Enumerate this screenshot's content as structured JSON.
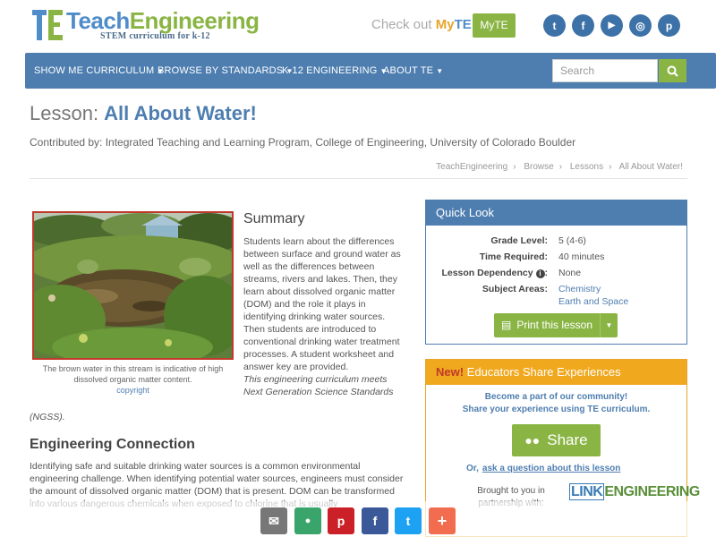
{
  "header": {
    "logo": {
      "part1": "Teach",
      "part2": "Engineering",
      "tagline": "STEM curriculum for k-12"
    },
    "checkout": {
      "prefix": "Check out ",
      "my": "My",
      "te": "TE"
    },
    "myte_button": "MyTE",
    "socials": [
      {
        "icon": "twitter-icon",
        "glyph": "t"
      },
      {
        "icon": "facebook-icon",
        "glyph": "f"
      },
      {
        "icon": "youtube-icon",
        "glyph": "▶"
      },
      {
        "icon": "instagram-icon",
        "glyph": "◎"
      },
      {
        "icon": "pinterest-icon",
        "glyph": "p"
      }
    ]
  },
  "nav": {
    "items": [
      "SHOW ME CURRICULUM",
      "BROWSE BY STANDARDS",
      "K-12 ENGINEERING",
      "ABOUT TE"
    ],
    "search_placeholder": "Search"
  },
  "lesson": {
    "prefix": "Lesson: ",
    "title": "All About Water!",
    "contributed": "Contributed by: Integrated Teaching and Learning Program, College of Engineering, University of Colorado Boulder"
  },
  "breadcrumb": [
    "TeachEngineering",
    "Browse",
    "Lessons",
    "All About Water!"
  ],
  "figure": {
    "caption": "The brown water in this stream is indicative of high dissolved organic matter content.",
    "credit": "copyright"
  },
  "summary": {
    "heading": "Summary",
    "body": "Students learn about the differences between surface and ground water as well as the differences between streams, rivers and lakes. Then, they learn about dissolved organic matter (DOM) and the role it plays in identifying drinking water sources. Then students are introduced to conventional drinking water treatment processes. A student worksheet and answer key are provided.",
    "ngss_1": "This engineering curriculum meets",
    "ngss_2": "Next Generation Science Standards",
    "ngss_3": "(NGSS)."
  },
  "engineering": {
    "heading": "Engineering Connection",
    "body": "Identifying safe and suitable drinking water sources is a common environmental engineering challenge. When identifying potential water sources, engineers must consider the amount of dissolved organic matter (DOM) that is present. DOM can be transformed into various dangerous chemicals when exposed to chlorine that is usually"
  },
  "quick_look": {
    "heading": "Quick Look",
    "grade_label": "Grade Level:",
    "grade_value": "5 (4-6)",
    "time_label": "Time Required:",
    "time_value": "40 minutes",
    "dependency_label": "Lesson Dependency",
    "dependency_value": "None",
    "subjects_label": "Subject Areas:",
    "subjects": [
      "Chemistry",
      "Earth and Space"
    ],
    "print_label": "Print this lesson"
  },
  "share_box": {
    "new": "New!",
    "heading": " Educators Share Experiences",
    "line1": "Become a part of our community!",
    "line2": "Share your experience using TE curriculum.",
    "share_label": "Share",
    "or": "Or,",
    "ask_link": "ask a question about this lesson",
    "brought": "Brought to you in partnership with:",
    "partner_1": "LINK",
    "partner_2": "ENGINEERING"
  },
  "share_bar": [
    {
      "icon": "email-icon",
      "glyph": "✉",
      "color": "#777777"
    },
    {
      "icon": "group-icon",
      "glyph": "●",
      "color": "#3aa56b"
    },
    {
      "icon": "pinterest-icon",
      "glyph": "p",
      "color": "#cb2027"
    },
    {
      "icon": "facebook-icon",
      "glyph": "f",
      "color": "#3b5998"
    },
    {
      "icon": "twitter-icon",
      "glyph": "t",
      "color": "#1da1f2"
    },
    {
      "icon": "plus-icon",
      "glyph": "+",
      "color": "#f26c4f"
    }
  ],
  "colors": {
    "brand_blue": "#4e7eb0",
    "brand_green": "#8ab544",
    "accent_orange": "#f0a81e"
  }
}
